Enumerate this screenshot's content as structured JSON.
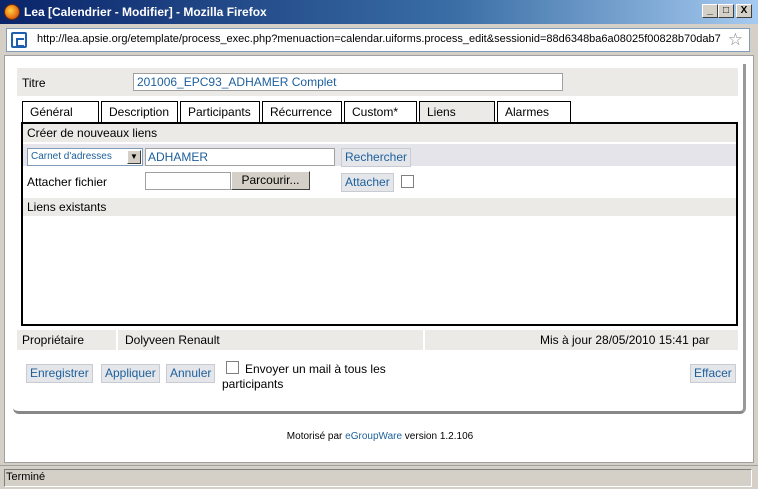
{
  "window": {
    "title": "Lea [Calendrier - Modifier] - Mozilla Firefox",
    "minimize_label": "_",
    "maximize_label": "□",
    "close_label": "X"
  },
  "urlbar": {
    "url": "http://lea.apsie.org/etemplate/process_exec.php?menuaction=calendar.uiforms.process_edit&sessionid=88d6348ba6a08025f00828b70dab7"
  },
  "form": {
    "title_label": "Titre",
    "title_value": "201006_EPC93_ADHAMER Complet",
    "tabs": [
      {
        "label": "Général"
      },
      {
        "label": "Description"
      },
      {
        "label": "Participants"
      },
      {
        "label": "Récurrence"
      },
      {
        "label": "Custom*"
      },
      {
        "label": "Liens"
      },
      {
        "label": "Alarmes"
      }
    ],
    "active_tab": "Liens",
    "links": {
      "create_heading": "Créer de nouveaux liens",
      "app_select_value": "Carnet d'adresses",
      "search_value": "ADHAMER",
      "search_button": "Rechercher",
      "attach_file_label": "Attacher fichier",
      "browse_button": "Parcourir...",
      "attach_button": "Attacher",
      "existing_heading": "Liens existants"
    },
    "owner_label": "Propriétaire",
    "owner_value": "Dolyveen Renault",
    "updated_text": "Mis à jour 28/05/2010 15:41 par",
    "buttons": {
      "save": "Enregistrer",
      "apply": "Appliquer",
      "cancel": "Annuler",
      "delete": "Effacer"
    },
    "mail_checkbox_label_line1": "Envoyer un mail à tous les",
    "mail_checkbox_label_line2": "participants"
  },
  "footer": {
    "powered_prefix": "Motorisé par ",
    "powered_link": "eGroupWare",
    "powered_suffix": " version 1.2.106"
  },
  "status": {
    "text": "Terminé"
  },
  "colors": {
    "link_blue": "#1c5f9c",
    "section_grey": "#ebeae6"
  }
}
